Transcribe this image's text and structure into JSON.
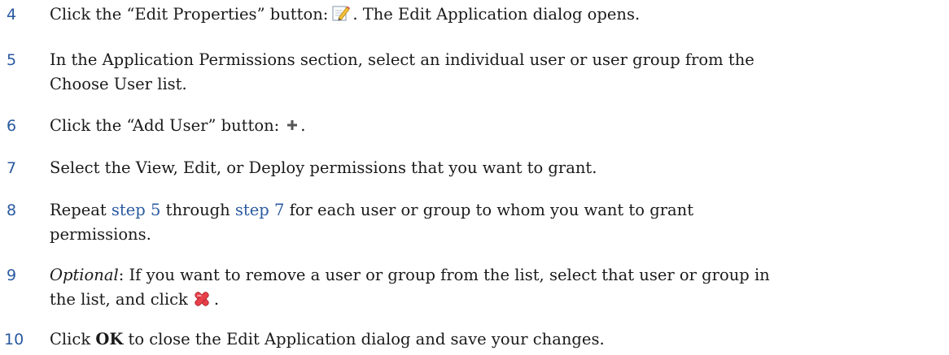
{
  "steps": [
    {
      "number": "4",
      "pre": "Click the “Edit Properties” button:",
      "icon": "edit-properties-icon",
      "post": ". The Edit Application dialog opens."
    },
    {
      "number": "5",
      "line1": "In the Application Permissions section, select an individual user or user group from the",
      "line2": "Choose User list."
    },
    {
      "number": "6",
      "pre": "Click the “Add User” button:",
      "icon": "add-user-plus-icon",
      "post": "."
    },
    {
      "number": "7",
      "text": "Select the View, Edit, or Deploy permissions that you want to grant."
    },
    {
      "number": "8",
      "pre": "Repeat",
      "link1": "step 5",
      "mid": "through",
      "link2": "step 7",
      "post": "for each user or group to whom you want to grant",
      "line2": "permissions."
    },
    {
      "number": "9",
      "optional": "Optional",
      "line1_rest": ": If you want to remove a user or group from the list, select that user or group in",
      "line2_pre": "the list, and click",
      "icon": "remove-red-x-icon",
      "line2_post": "."
    },
    {
      "number": "10",
      "pre": "Click",
      "bold": "OK",
      "post": "to close the Edit Application dialog and save your changes."
    }
  ],
  "colors": {
    "step_number": "#2a5aa0",
    "link": "#2a5aa0",
    "text": "#1a1a1a"
  }
}
